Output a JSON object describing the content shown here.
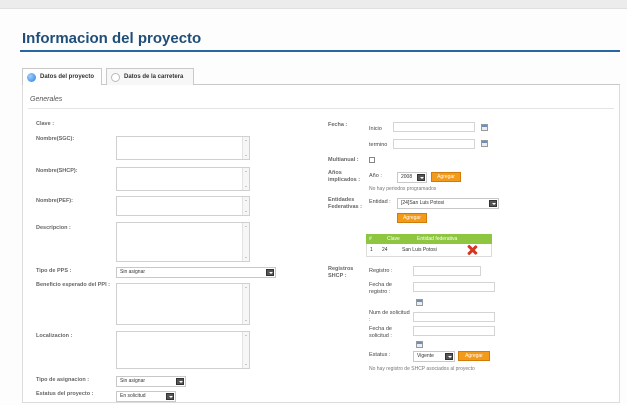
{
  "page": {
    "title": "Informacion del proyecto"
  },
  "tabs": [
    {
      "label": "Datos del proyecto"
    },
    {
      "label": "Datos de la carretera"
    }
  ],
  "section": {
    "title": "Generales"
  },
  "left": {
    "clave_label": "Clave :",
    "nombre_sct_label": "Nombre(SGC):",
    "nombre_shcp_label": "Nombre(SHCP):",
    "nombre_pef_label": "Nombre(PEF):",
    "descripcion_label": "Descripcion :",
    "tipo_pps_label": "Tipo de PPS :",
    "tipo_pps_value": "Sin asignar",
    "beneficio_label": "Beneficio esperado del PPI :",
    "localizacion_label": "Localizacion :",
    "tipo_asignacion_label": "Tipo de asignacion :",
    "tipo_asignacion_value": "Sin asignar",
    "estatus_label": "Estatus del proyecto :",
    "estatus_value": "En solicitud"
  },
  "right": {
    "fecha_label": "Fecha :",
    "inicio_label": "Inicio",
    "termino_label": "termino",
    "multianual_label": "Multianual :",
    "anios_label": "Años implicados :",
    "anio_label": "Año :",
    "anio_value": "2008",
    "agregar_label": "Agregar",
    "no_periodos": "No hay periodos programados",
    "entidades_label": "Entidades Federativas :",
    "entidad_label": "Entidad :",
    "entidad_value": "[24]San Luis Potosi",
    "table": {
      "headers": [
        "Clave",
        "Entidad federativa"
      ],
      "rows": [
        {
          "num": "1",
          "clave": "24",
          "entidad": "San Luis Potosi"
        }
      ]
    },
    "registros_label": "Registros SHCP :",
    "registro_label": "Registro :",
    "fecha_registro_label": "Fecha de registro :",
    "num_solicitud_label": "Num de solicitud :",
    "fecha_solicitud_label": "Fecha de solicitud :",
    "estatus_label": "Estatus :",
    "estatus_value": "Vigente",
    "no_registros": "No hay registro de SHCP asociados al proyecto"
  },
  "colors": {
    "title": "#1f4e79",
    "accent_button": "#f39a1b",
    "table_header": "#8ec63f",
    "delete_icon": "#d9341e"
  }
}
